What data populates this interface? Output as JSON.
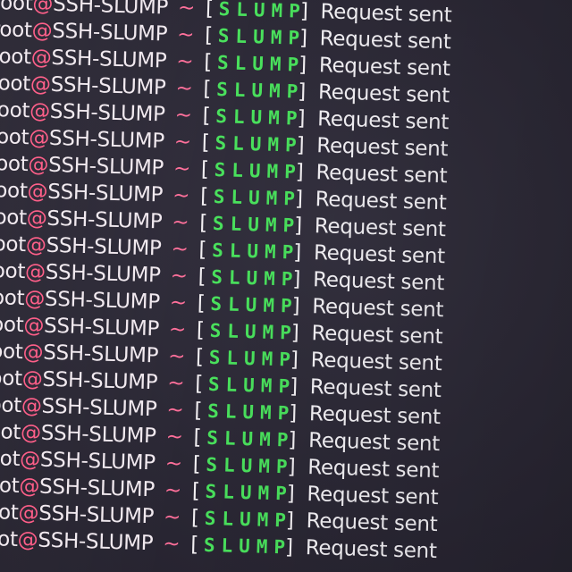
{
  "terminal": {
    "prompt_user": "root",
    "prompt_at": "@",
    "prompt_host": "SSH-SLUMP",
    "prompt_path": "~",
    "bracket_open": "[",
    "tag": "SLUMP",
    "bracket_close": "]",
    "message": "Request sent",
    "colors": {
      "background": "#2b2938",
      "at_sign": "#ff5b86",
      "tilde": "#ff6f9a",
      "tag": "#49e05c",
      "text": "#f1e9ef"
    },
    "line_count": 21
  }
}
